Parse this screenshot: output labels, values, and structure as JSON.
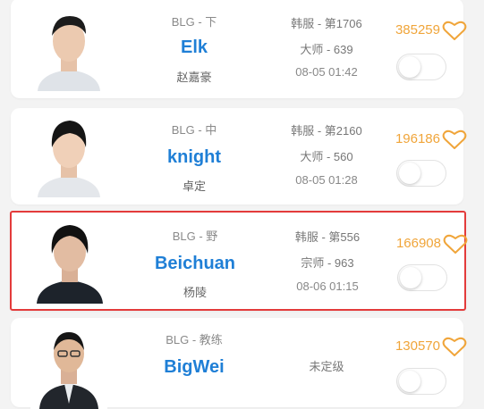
{
  "players": [
    {
      "team_role": "BLG - 下",
      "name": "Elk",
      "real_name": "赵嘉豪",
      "server_rank": "韩服 - 第1706",
      "tier": "大师 - 639",
      "time": "08-05 01:42",
      "likes": "385259",
      "toggle_on": false
    },
    {
      "team_role": "BLG - 中",
      "name": "knight",
      "real_name": "卓定",
      "server_rank": "韩服 - 第2160",
      "tier": "大师 - 560",
      "time": "08-05 01:28",
      "likes": "196186",
      "toggle_on": false
    },
    {
      "team_role": "BLG - 野",
      "name": "Beichuan",
      "real_name": "杨陵",
      "server_rank": "韩服 - 第556",
      "tier": "宗师 - 963",
      "time": "08-06 01:15",
      "likes": "166908",
      "toggle_on": false
    },
    {
      "team_role": "BLG - 教练",
      "name": "BigWei",
      "real_name": "",
      "server_rank": "",
      "tier": "未定级",
      "time": "",
      "likes": "130570",
      "toggle_on": false
    }
  ],
  "colors": {
    "name": "#1f7fd6",
    "likes": "#f0a53a",
    "selected_border": "#e33b3b"
  },
  "icons": {
    "like": "heart-outline-icon",
    "avatar": "player-avatar"
  }
}
